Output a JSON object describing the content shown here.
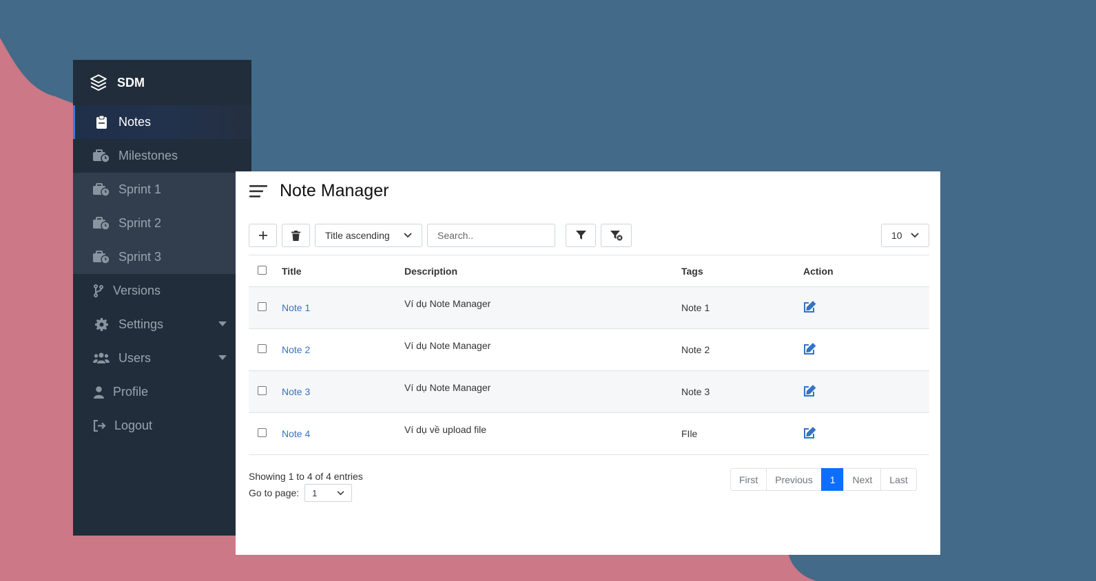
{
  "colors": {
    "background": "#436a88",
    "blob": "#cc7887",
    "sidebar": "#222d3b",
    "accent": "#3573c4",
    "active_page": "#0d6efd"
  },
  "sidebar": {
    "brand": "SDM",
    "items": [
      {
        "label": "Notes",
        "icon": "clipboard-icon"
      },
      {
        "label": "Milestones",
        "icon": "briefcase-clock-icon"
      },
      {
        "label": "Sprint 1",
        "icon": "briefcase-clock-icon"
      },
      {
        "label": "Sprint 2",
        "icon": "briefcase-clock-icon"
      },
      {
        "label": "Sprint 3",
        "icon": "briefcase-clock-icon"
      },
      {
        "label": "Versions",
        "icon": "code-branch-icon"
      },
      {
        "label": "Settings",
        "icon": "gear-icon"
      },
      {
        "label": "Users",
        "icon": "users-icon"
      },
      {
        "label": "Profile",
        "icon": "user-icon"
      },
      {
        "label": "Logout",
        "icon": "sign-out-icon"
      }
    ]
  },
  "main": {
    "title": "Note Manager",
    "toolbar": {
      "sort_value": "Title ascending",
      "search_placeholder": "Search..",
      "page_size": "10"
    },
    "table": {
      "headers": {
        "title": "Title",
        "description": "Description",
        "tags": "Tags",
        "action": "Action"
      },
      "rows": [
        {
          "title": "Note 1",
          "description": "Ví dụ Note Manager",
          "tags": "Note 1"
        },
        {
          "title": "Note 2",
          "description": "Ví dụ Note Manager",
          "tags": "Note 2"
        },
        {
          "title": "Note 3",
          "description": "Ví dụ Note Manager",
          "tags": "Note 3"
        },
        {
          "title": "Note 4",
          "description": "Ví dụ về upload file",
          "tags": "FIle"
        }
      ]
    },
    "footer": {
      "showing": "Showing 1 to 4 of 4 entries",
      "goto_label": "Go to page:",
      "goto_value": "1",
      "pagination": {
        "first": "First",
        "previous": "Previous",
        "current": "1",
        "next": "Next",
        "last": "Last"
      }
    }
  }
}
